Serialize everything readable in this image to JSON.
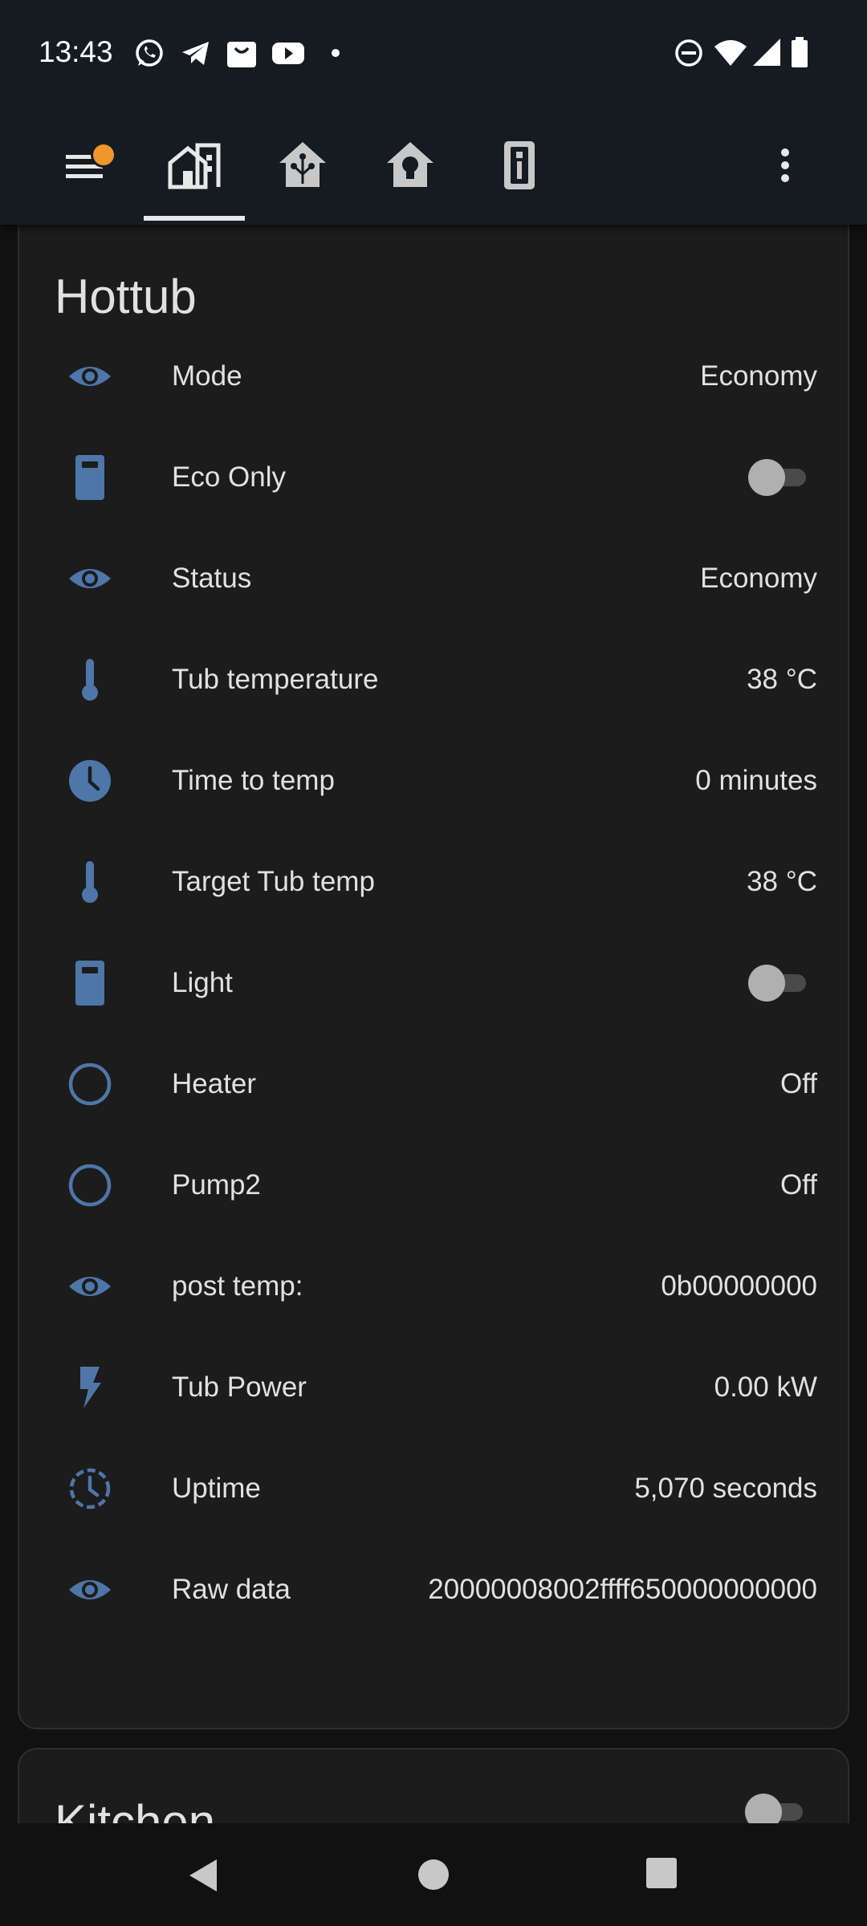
{
  "status_bar": {
    "time": "13:43",
    "notification_icons": [
      "whatsapp-icon",
      "telegram-icon",
      "shop-icon",
      "youtube-icon",
      "dot-icon"
    ],
    "system_icons": [
      "dnd-icon",
      "wifi-icon",
      "signal-icon",
      "battery-icon"
    ]
  },
  "app_bar": {
    "menu_badge_color": "#f0962c",
    "tabs": [
      "home-overview-icon",
      "home-automation-icon",
      "home-lightbulb-icon",
      "device-remote-icon"
    ],
    "active_tab_index": 0,
    "overflow_icon": "dots-vertical-icon"
  },
  "colors": {
    "accent_icon": "#4e76a8",
    "background": "#111111",
    "card": "#1c1c1c",
    "text": "#e1e1e1"
  },
  "hottub_card": {
    "title": "Hottub",
    "rows": [
      {
        "icon": "eye-icon",
        "name": "Mode",
        "value": "Economy",
        "type": "value"
      },
      {
        "icon": "remote-icon",
        "name": "Eco Only",
        "type": "toggle",
        "on": false
      },
      {
        "icon": "eye-icon",
        "name": "Status",
        "value": "Economy",
        "type": "value"
      },
      {
        "icon": "thermometer-icon",
        "name": "Tub temperature",
        "value": "38 °C",
        "type": "value"
      },
      {
        "icon": "clock-icon",
        "name": "Time to temp",
        "value": "0 minutes",
        "type": "value"
      },
      {
        "icon": "thermometer-icon",
        "name": "Target Tub temp",
        "value": "38 °C",
        "type": "value"
      },
      {
        "icon": "remote-icon",
        "name": "Light",
        "type": "toggle",
        "on": false
      },
      {
        "icon": "circle-outline-icon",
        "name": "Heater",
        "value": "Off",
        "type": "value"
      },
      {
        "icon": "circle-outline-icon",
        "name": "Pump2",
        "value": "Off",
        "type": "value"
      },
      {
        "icon": "eye-icon",
        "name": "post temp:",
        "value": "0b00000000",
        "type": "value"
      },
      {
        "icon": "flash-icon",
        "name": "Tub Power",
        "value": "0.00 kW",
        "type": "value"
      },
      {
        "icon": "timer-outline-icon",
        "name": "Uptime",
        "value": "5,070 seconds",
        "type": "value"
      },
      {
        "icon": "eye-icon",
        "name": "Raw data",
        "value": "20000008002ffff650000000000",
        "type": "value"
      }
    ]
  },
  "kitchen_card": {
    "title": "Kitchen",
    "toggle_on": false
  },
  "nav_bar": {
    "buttons": [
      "back-icon",
      "home-icon",
      "recents-icon"
    ]
  }
}
